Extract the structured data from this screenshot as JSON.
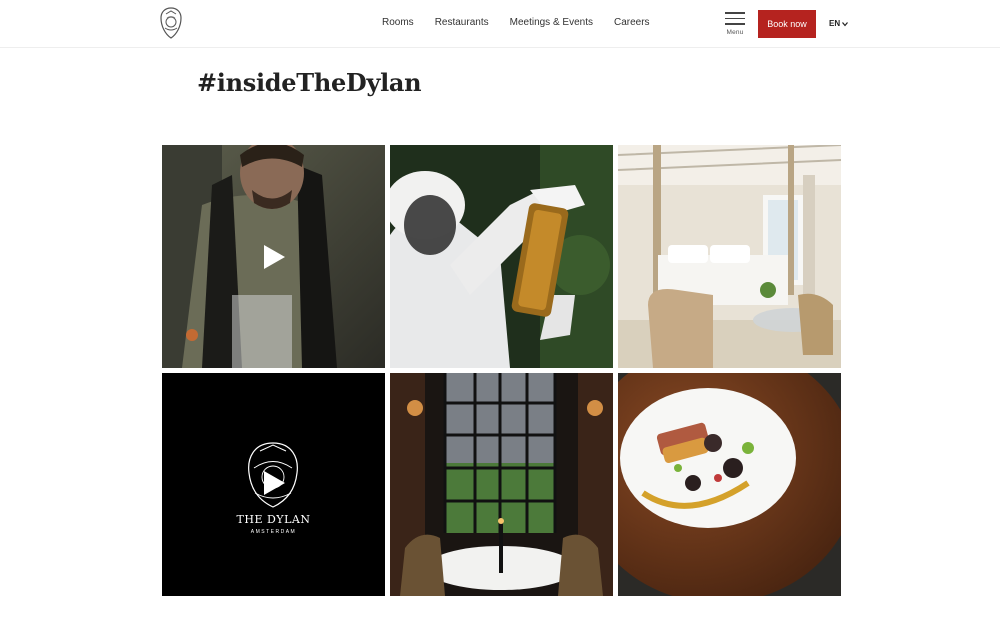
{
  "header": {
    "logo_icon": "hotel-crest-icon",
    "nav": [
      {
        "label": "Rooms"
      },
      {
        "label": "Restaurants"
      },
      {
        "label": "Meetings & Events"
      },
      {
        "label": "Careers"
      }
    ],
    "menu_label": "Menu",
    "book_label": "Book now",
    "language": "EN",
    "accent_color": "#b5231f"
  },
  "section": {
    "title": "#insideTheDylan"
  },
  "gallery": {
    "tiles": [
      {
        "subject": "chef-photo",
        "video": true
      },
      {
        "subject": "beekeeper-photo",
        "video": false
      },
      {
        "subject": "bedroom-photo",
        "video": false
      },
      {
        "subject": "brand-video",
        "video": true,
        "brand_name": "THE DYLAN",
        "brand_city": "AMSTERDAM"
      },
      {
        "subject": "dining-window-photo",
        "video": false
      },
      {
        "subject": "plated-dish-photo",
        "video": false
      }
    ]
  }
}
